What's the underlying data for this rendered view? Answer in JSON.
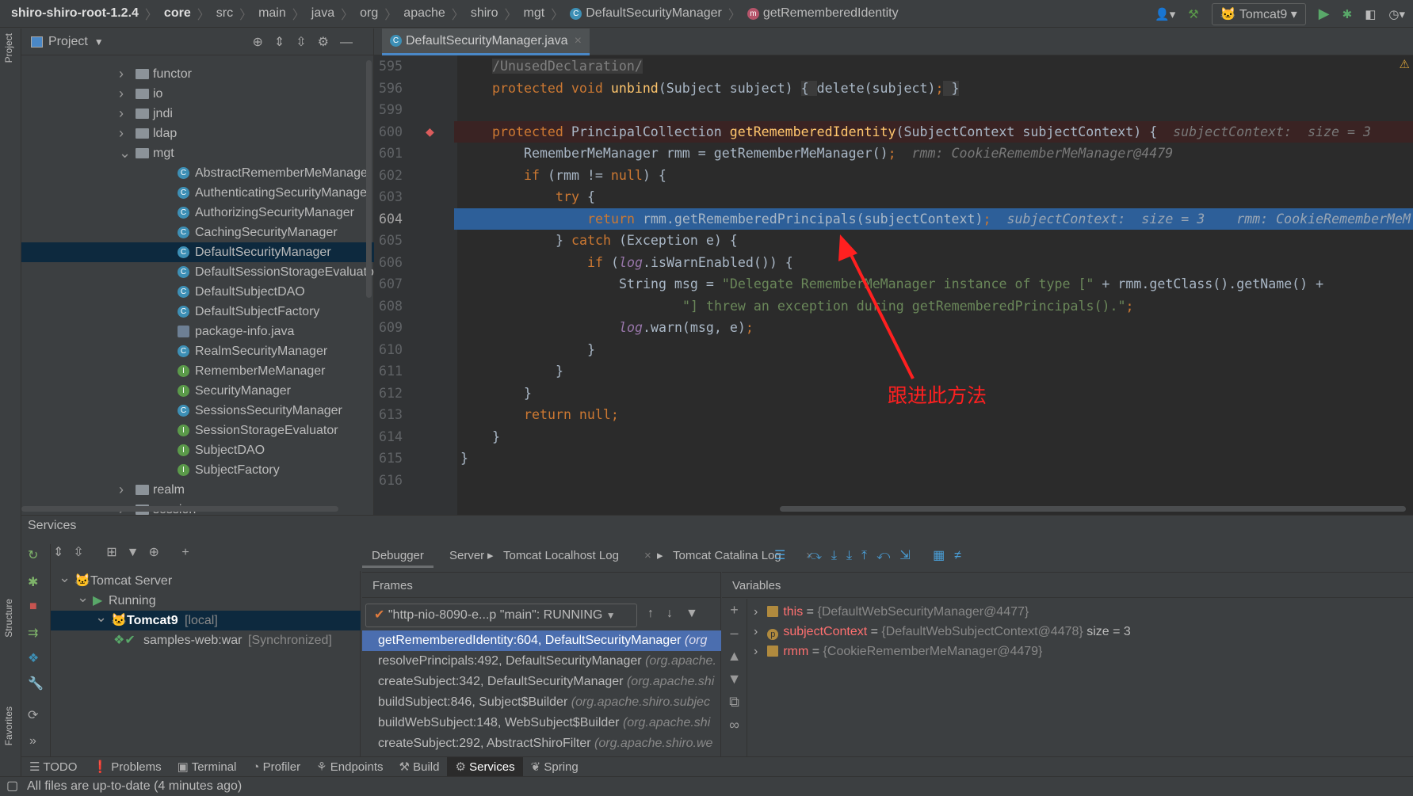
{
  "breadcrumb": [
    "shiro-shiro-root-1.2.4",
    "core",
    "src",
    "main",
    "java",
    "org",
    "apache",
    "shiro",
    "mgt",
    "DefaultSecurityManager",
    "getRememberedIdentity"
  ],
  "run_config": "Tomcat9",
  "left_strip": {
    "project": "Project",
    "structure": "Structure",
    "favorites": "Favorites"
  },
  "project": {
    "title": "Project",
    "tree": [
      {
        "label": "functor",
        "type": "folder",
        "level": 0,
        "expanded": false
      },
      {
        "label": "io",
        "type": "folder",
        "level": 0,
        "expanded": false
      },
      {
        "label": "jndi",
        "type": "folder",
        "level": 0,
        "expanded": false
      },
      {
        "label": "ldap",
        "type": "folder",
        "level": 0,
        "expanded": false
      },
      {
        "label": "mgt",
        "type": "folder",
        "level": 0,
        "expanded": true
      },
      {
        "label": "AbstractRememberMeManager",
        "type": "class",
        "level": 1
      },
      {
        "label": "AuthenticatingSecurityManager",
        "type": "class",
        "level": 1
      },
      {
        "label": "AuthorizingSecurityManager",
        "type": "class",
        "level": 1
      },
      {
        "label": "CachingSecurityManager",
        "type": "class",
        "level": 1
      },
      {
        "label": "DefaultSecurityManager",
        "type": "class",
        "level": 1,
        "selected": true
      },
      {
        "label": "DefaultSessionStorageEvaluator",
        "type": "class",
        "level": 1
      },
      {
        "label": "DefaultSubjectDAO",
        "type": "class",
        "level": 1
      },
      {
        "label": "DefaultSubjectFactory",
        "type": "class",
        "level": 1
      },
      {
        "label": "package-info.java",
        "type": "file",
        "level": 1
      },
      {
        "label": "RealmSecurityManager",
        "type": "class",
        "level": 1
      },
      {
        "label": "RememberMeManager",
        "type": "interface",
        "level": 1
      },
      {
        "label": "SecurityManager",
        "type": "interface",
        "level": 1
      },
      {
        "label": "SessionsSecurityManager",
        "type": "class",
        "level": 1
      },
      {
        "label": "SessionStorageEvaluator",
        "type": "interface",
        "level": 1
      },
      {
        "label": "SubjectDAO",
        "type": "interface",
        "level": 1
      },
      {
        "label": "SubjectFactory",
        "type": "interface",
        "level": 1
      },
      {
        "label": "realm",
        "type": "folder",
        "level": 0,
        "expanded": false
      },
      {
        "label": "session",
        "type": "folder",
        "level": 0,
        "expanded": false
      }
    ]
  },
  "editor": {
    "tab": "DefaultSecurityManager.java",
    "lines": [
      {
        "n": "595",
        "indent": 1,
        "t": [
          [
            "cmt",
            "/UnusedDeclaration/"
          ]
        ]
      },
      {
        "n": "596",
        "indent": 1,
        "t": [
          [
            "kw",
            "protected void "
          ],
          [
            "fn",
            "unbind"
          ],
          [
            "p",
            "(Subject subject) "
          ],
          [
            "fold",
            "{ "
          ],
          [
            "p",
            "delete(subject)"
          ],
          [
            "kw",
            ";"
          ],
          [
            "fold",
            " }"
          ]
        ]
      },
      {
        "n": "599",
        "indent": 1,
        "t": []
      },
      {
        "n": "600",
        "indent": 1,
        "state": "breakpoint",
        "t": [
          [
            "kw",
            "protected "
          ],
          [
            "p",
            "PrincipalCollection "
          ],
          [
            "fn",
            "getRememberedIdentity"
          ],
          [
            "p",
            "(SubjectContext subjectContext) {"
          ],
          [
            "hint",
            "  subjectContext:  size = 3"
          ]
        ]
      },
      {
        "n": "601",
        "indent": 2,
        "t": [
          [
            "p",
            "RememberMeManager rmm = getRememberMeManager()"
          ],
          [
            "kw",
            ";"
          ],
          [
            "hint",
            "  rmm: CookieRememberMeManager@4479"
          ]
        ]
      },
      {
        "n": "602",
        "indent": 2,
        "t": [
          [
            "kw",
            "if "
          ],
          [
            "p",
            "(rmm != "
          ],
          [
            "kw",
            "null"
          ],
          [
            "p",
            ") {"
          ]
        ]
      },
      {
        "n": "603",
        "indent": 3,
        "t": [
          [
            "kw",
            "try "
          ],
          [
            "p",
            "{"
          ]
        ]
      },
      {
        "n": "604",
        "indent": 4,
        "state": "current",
        "t": [
          [
            "kw",
            "return "
          ],
          [
            "p",
            "rmm.getRememberedPrincipals(subjectContext)"
          ],
          [
            "kw",
            ";"
          ],
          [
            "hint",
            "  subjectContext:  size = 3    rmm: CookieRememberMeM"
          ]
        ]
      },
      {
        "n": "605",
        "indent": 3,
        "t": [
          [
            "p",
            "} "
          ],
          [
            "kw",
            "catch "
          ],
          [
            "p",
            "(Exception e) {"
          ]
        ]
      },
      {
        "n": "606",
        "indent": 4,
        "t": [
          [
            "kw",
            "if "
          ],
          [
            "p",
            "("
          ],
          [
            "field",
            "log"
          ],
          [
            "p",
            ".isWarnEnabled()) {"
          ]
        ]
      },
      {
        "n": "607",
        "indent": 5,
        "t": [
          [
            "p",
            "String msg = "
          ],
          [
            "str",
            "\"Delegate RememberMeManager instance of type [\""
          ],
          [
            "p",
            " + rmm.getClass().getName() +"
          ]
        ]
      },
      {
        "n": "608",
        "indent": 7,
        "t": [
          [
            "str",
            "\"] threw an exception during getRememberedPrincipals().\""
          ],
          [
            "kw",
            ";"
          ]
        ]
      },
      {
        "n": "609",
        "indent": 5,
        "t": [
          [
            "field",
            "log"
          ],
          [
            "p",
            ".warn(msg, e)"
          ],
          [
            "kw",
            ";"
          ]
        ]
      },
      {
        "n": "610",
        "indent": 4,
        "t": [
          [
            "p",
            "}"
          ]
        ]
      },
      {
        "n": "611",
        "indent": 3,
        "t": [
          [
            "p",
            "}"
          ]
        ]
      },
      {
        "n": "612",
        "indent": 2,
        "t": [
          [
            "p",
            "}"
          ]
        ]
      },
      {
        "n": "613",
        "indent": 2,
        "t": [
          [
            "kw",
            "return null"
          ],
          [
            "kw",
            ";"
          ]
        ]
      },
      {
        "n": "614",
        "indent": 1,
        "t": [
          [
            "p",
            "}"
          ]
        ]
      },
      {
        "n": "615",
        "indent": 0,
        "t": [
          [
            "p",
            "}"
          ]
        ]
      },
      {
        "n": "616",
        "indent": 0,
        "t": []
      }
    ]
  },
  "annotation": {
    "text": "跟进此方法",
    "color": "#ff2020"
  },
  "services": {
    "title": "Services",
    "tree": [
      {
        "label": "Tomcat Server",
        "level": 0
      },
      {
        "label": "Running",
        "level": 1
      },
      {
        "label": "Tomcat9",
        "suffix": "[local]",
        "level": 2,
        "selected": true
      },
      {
        "label": "samples-web:war",
        "suffix": "[Synchronized]",
        "level": 3
      }
    ],
    "tabs": [
      "Debugger",
      "Server",
      "Tomcat Localhost Log",
      "Tomcat Catalina Log"
    ],
    "active_tab": "Debugger",
    "frames_title": "Frames",
    "thread": "\"http-nio-8090-e...p \"main\": RUNNING",
    "frames": [
      {
        "m": "getRememberedIdentity:604, DefaultSecurityManager",
        "pkg": "(org"
      },
      {
        "m": "resolvePrincipals:492, DefaultSecurityManager",
        "pkg": "(org.apache."
      },
      {
        "m": "createSubject:342, DefaultSecurityManager",
        "pkg": "(org.apache.shi"
      },
      {
        "m": "buildSubject:846, Subject$Builder",
        "pkg": "(org.apache.shiro.subjec"
      },
      {
        "m": "buildWebSubject:148, WebSubject$Builder",
        "pkg": "(org.apache.shi"
      },
      {
        "m": "createSubject:292, AbstractShiroFilter",
        "pkg": "(org.apache.shiro.we"
      }
    ],
    "variables_title": "Variables",
    "variables": [
      {
        "name": "this",
        "eq": " = ",
        "val": "{DefaultWebSecurityManager@4477}",
        "extra": "",
        "icon": "field"
      },
      {
        "name": "subjectContext",
        "eq": " = ",
        "val": "{DefaultWebSubjectContext@4478}",
        "extra": " size = 3",
        "icon": "param"
      },
      {
        "name": "rmm",
        "eq": " = ",
        "val": "{CookieRememberMeManager@4479}",
        "extra": "",
        "icon": "field"
      }
    ]
  },
  "bottom_tabs": [
    "TODO",
    "Problems",
    "Terminal",
    "Profiler",
    "Endpoints",
    "Build",
    "Services",
    "Spring"
  ],
  "bottom_active": "Services",
  "status": "All files are up-to-date (4 minutes ago)"
}
